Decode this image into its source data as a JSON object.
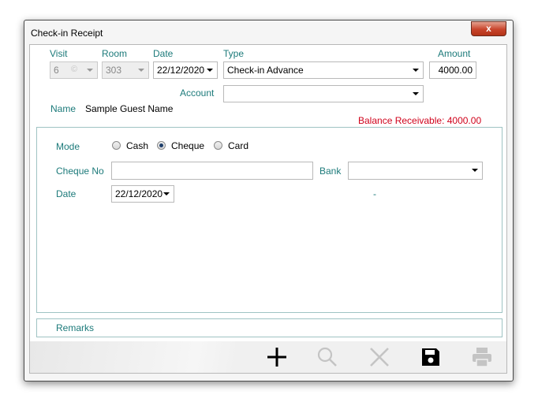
{
  "window": {
    "title": "Check-in Receipt",
    "close_glyph": "x"
  },
  "header": {
    "visit_label": "Visit",
    "visit_value": "6",
    "room_label": "Room",
    "room_value": "303",
    "date_label": "Date",
    "date_value": "22/12/2020",
    "type_label": "Type",
    "type_value": "Check-in Advance",
    "amount_label": "Amount",
    "amount_value": "4000.00",
    "account_label": "Account",
    "account_value": "",
    "name_label": "Name",
    "name_value": "Sample Guest Name",
    "balance_text": "Balance Receivable: 4000.00"
  },
  "payment": {
    "mode_label": "Mode",
    "modes": [
      {
        "label": "Cash",
        "selected": false
      },
      {
        "label": "Cheque",
        "selected": true
      },
      {
        "label": "Card",
        "selected": false
      }
    ],
    "cheque_no_label": "Cheque No",
    "cheque_no_value": "",
    "bank_label": "Bank",
    "bank_value": "",
    "date_label": "Date",
    "date_value": "22/12/2020",
    "dash": "-"
  },
  "remarks": {
    "label": "Remarks"
  },
  "toolbar": {
    "buttons": [
      {
        "icon": "add-icon",
        "enabled": true
      },
      {
        "icon": "search-icon",
        "enabled": false
      },
      {
        "icon": "cancel-icon",
        "enabled": false
      },
      {
        "icon": "save-icon",
        "enabled": true
      },
      {
        "icon": "print-icon",
        "enabled": false
      }
    ]
  },
  "colors": {
    "label_teal": "#1c7a7a",
    "balance_red": "#d0021b",
    "close_red": "#c8442b"
  }
}
